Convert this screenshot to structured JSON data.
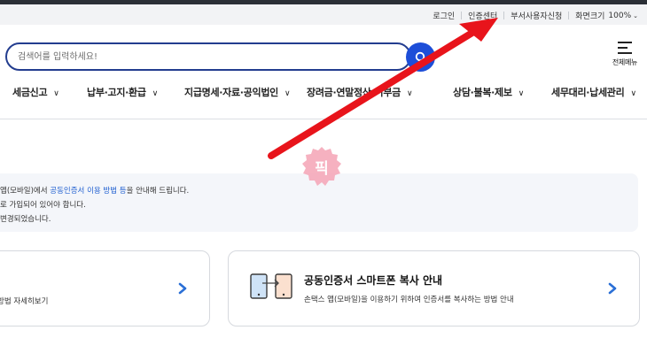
{
  "util_nav": {
    "items": [
      {
        "label": "로그인"
      },
      {
        "label": "인증센터"
      },
      {
        "label": "부서사용자신청"
      },
      {
        "label": "화면크기"
      }
    ],
    "zoom_value": "100%"
  },
  "search": {
    "placeholder": "검색어를 입력하세요!"
  },
  "menu_all": {
    "label": "전체메뉴"
  },
  "gnb": {
    "items": [
      {
        "label": "세금신고"
      },
      {
        "label": "납부·고지·환급"
      },
      {
        "label": "지급명세·자료·공익법인"
      },
      {
        "label": "장려금·연말정산·기부금"
      },
      {
        "label": "상담·불복·제보"
      },
      {
        "label": "세무대리·납세관리"
      }
    ]
  },
  "info": {
    "line1_prefix": "앱(모바일)에서 ",
    "line1_link": "공동인증서 이용 방법 등",
    "line1_suffix": "을 안내해 드립니다.",
    "line2": "로 가입되어 있어야 합니다.",
    "line3": "변경되었습니다."
  },
  "cards": {
    "left": {
      "desc": "방법 자세히보기"
    },
    "right": {
      "title": "공동인증서 스마트폰 복사 안내",
      "desc": "손택스 앱(모바일)을 이용하기 위하여 인증서를 복사하는 방법 안내"
    }
  },
  "overlay": {
    "badge_text": "픽",
    "arrow_color": "#e8141b",
    "badge_color": "#f4a3b5"
  },
  "colors": {
    "accent_blue": "#1d4ed8",
    "search_border": "#233d8f",
    "link_blue": "#1f5fd0"
  },
  "icons": {
    "search": "search-icon",
    "menu": "hamburger-menu-icon",
    "chevron": "chevron-down-icon",
    "arrow": "chevron-right-icon",
    "copy": "phone-copy-icon"
  }
}
